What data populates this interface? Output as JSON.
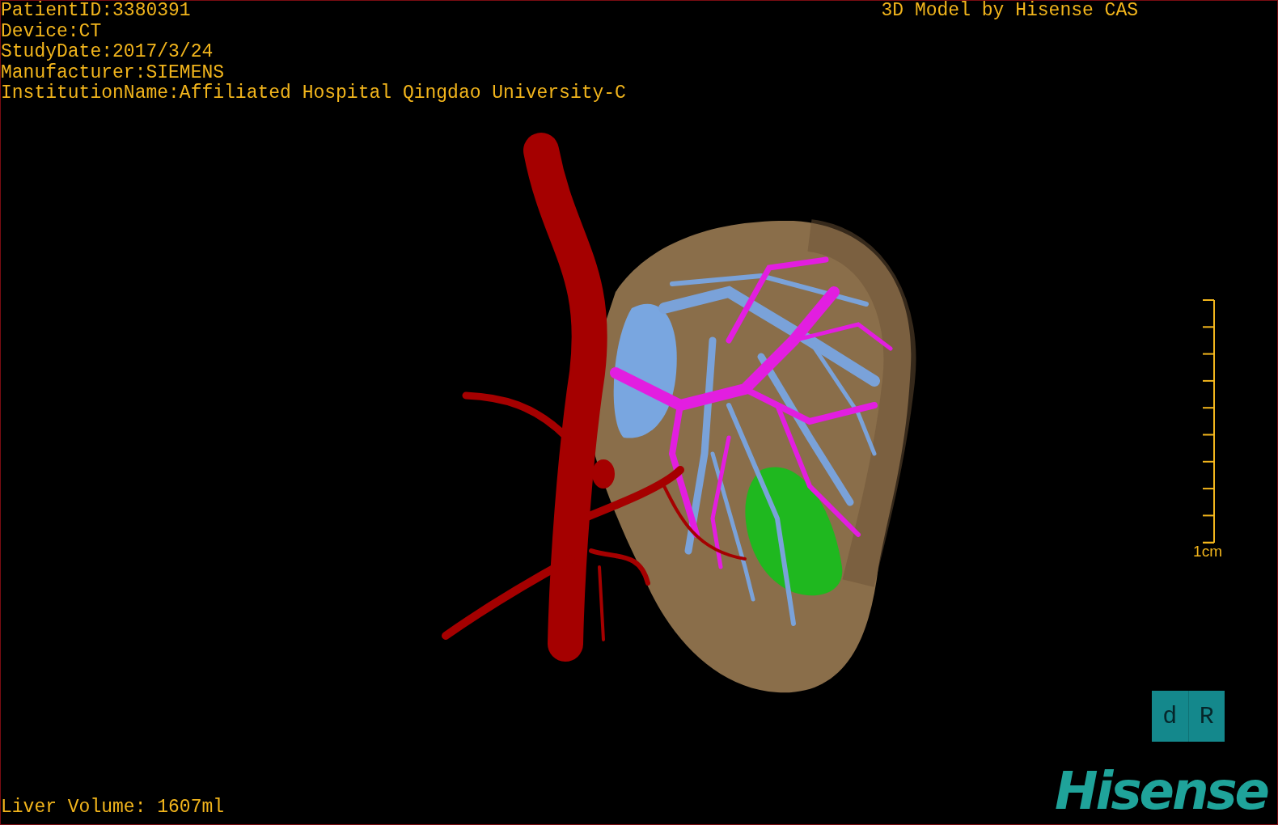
{
  "study_info": [
    "PatientID:3380391",
    "Device:CT",
    "StudyDate:2017/3/24",
    "Manufacturer:SIEMENS",
    "InstitutionName:Affiliated Hospital Qingdao University-C"
  ],
  "title": "3D Model by Hisense CAS",
  "scale_bar": {
    "label": "1cm"
  },
  "orientation_cube": {
    "labels": [
      "d",
      "R"
    ]
  },
  "liver_volume": "Liver Volume: 1607ml",
  "logo": "Hisense"
}
